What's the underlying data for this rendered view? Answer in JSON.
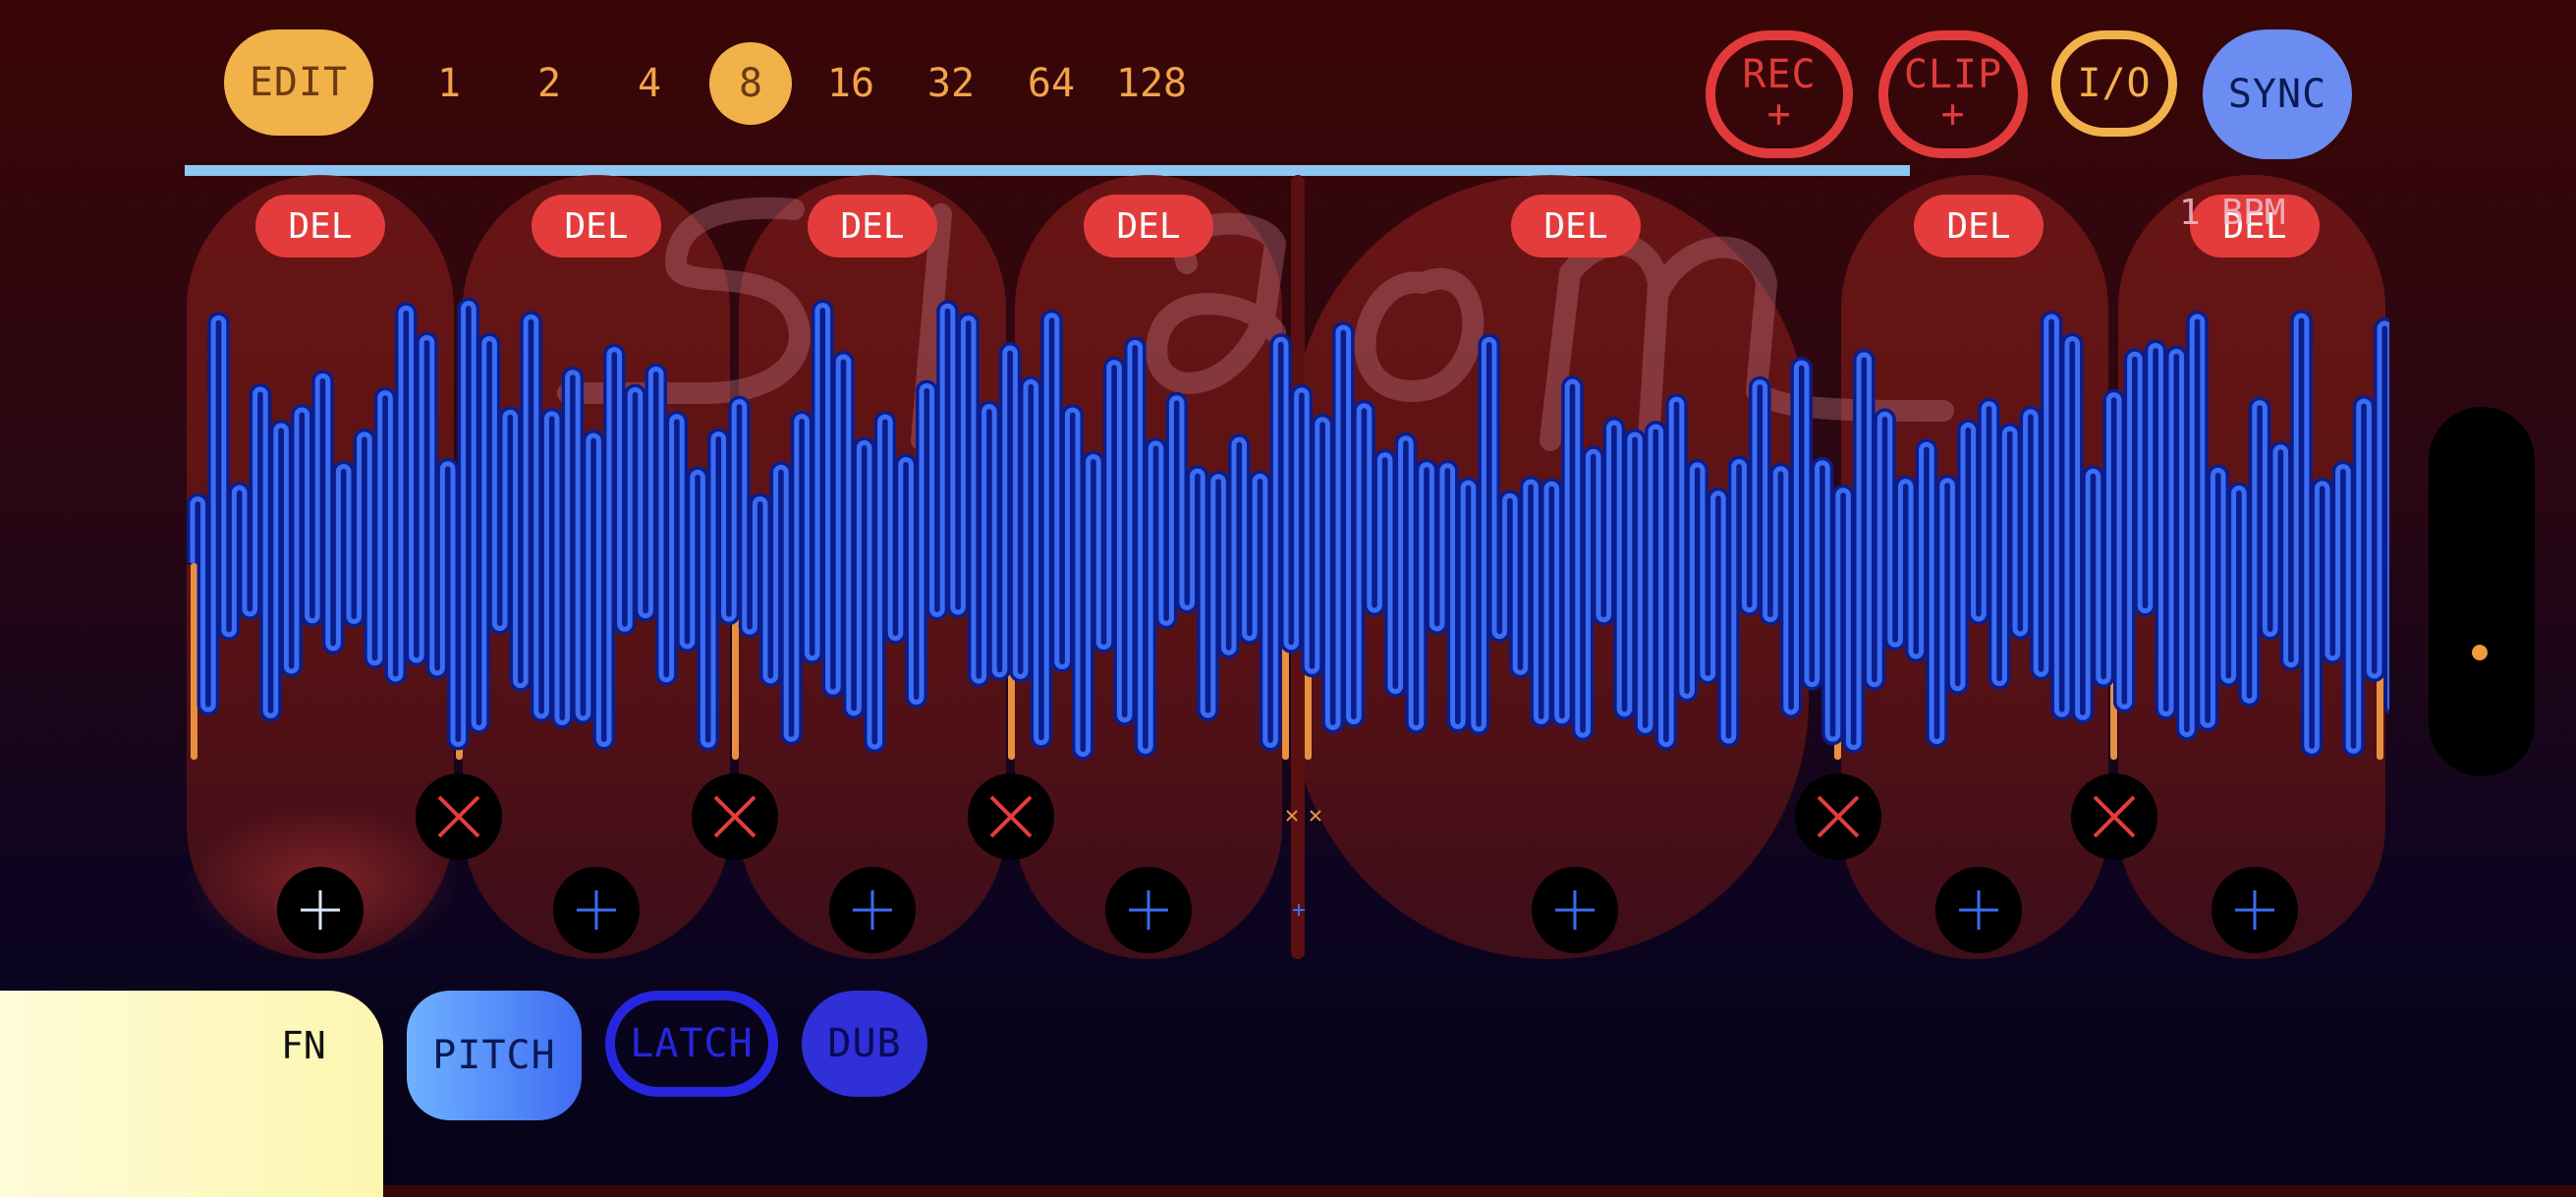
{
  "toolbar": {
    "edit_label": "EDIT",
    "divisions": [
      "1",
      "2",
      "4",
      "8",
      "16",
      "32",
      "64",
      "128"
    ],
    "active_division": "8",
    "rec_label": "REC",
    "rec_plus": "+",
    "clip_label": "CLIP",
    "clip_plus": "+",
    "io_label": "I/O",
    "sync_label": "SYNC"
  },
  "loops": {
    "del_label": "DEL",
    "count": 8
  },
  "tempo": {
    "bpm_label": "1   BPM"
  },
  "bottom": {
    "fn_label": "FN",
    "pitch_label": "PITCH",
    "latch_label": "LATCH",
    "dub_label": "DUB"
  },
  "colors": {
    "waveform": "#3b6cf2",
    "waveform_glow": "#0a1d8c",
    "accent_orange": "#f2b24a",
    "record_red": "#e23a3a",
    "sync_blue": "#6b8df2",
    "loop_bg": "#6e1616"
  },
  "icons": {
    "remove": "close-x-icon",
    "add": "plus-icon"
  }
}
